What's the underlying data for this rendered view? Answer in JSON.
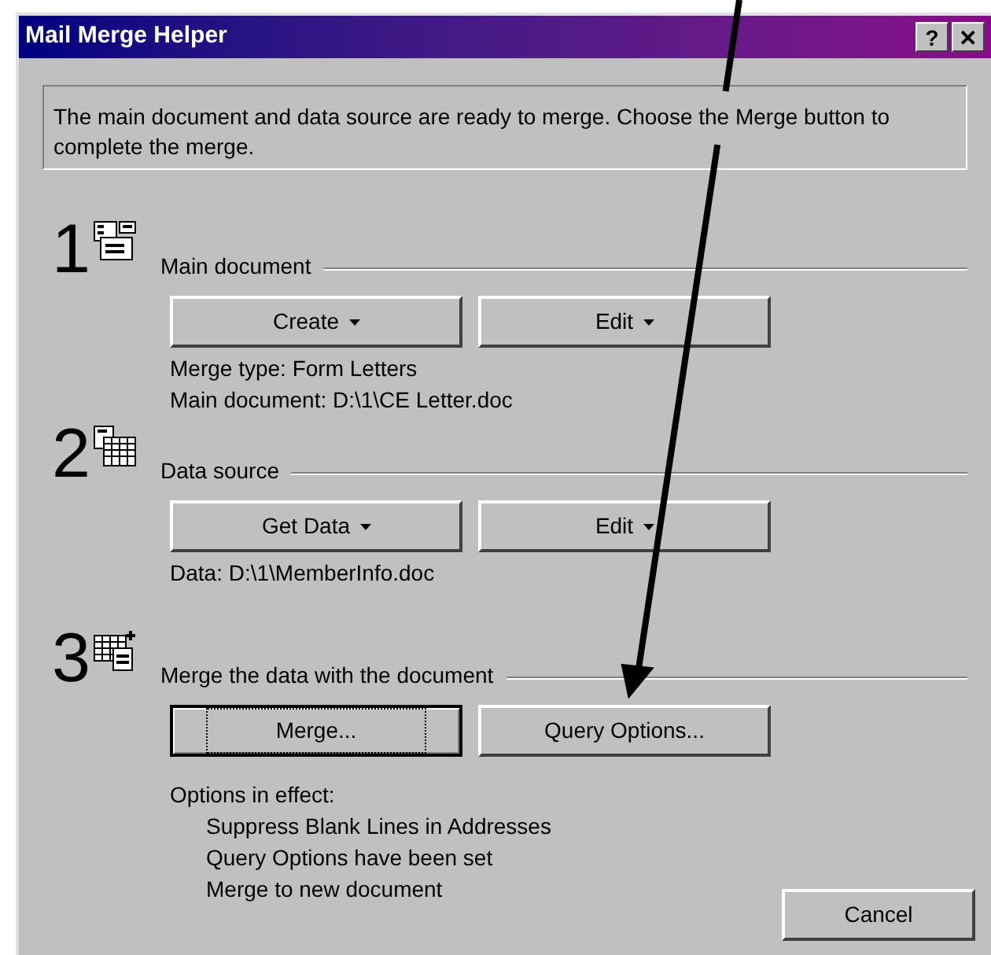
{
  "window": {
    "title": "Mail Merge Helper",
    "title_buttons": [
      "?",
      "✕"
    ]
  },
  "intro": "The main document and data source are ready to merge. Choose the Merge button to complete the merge.",
  "steps": [
    {
      "number": "1",
      "kind": "main",
      "heading": "Main document",
      "buttons": [
        {
          "label": "Create",
          "dropdown": true,
          "focused": false
        },
        {
          "label": "Edit",
          "dropdown": true,
          "focused": false
        }
      ],
      "info": [
        "Merge type: Form Letters",
        "Main document: D:\\1\\CE Letter.doc"
      ]
    },
    {
      "number": "2",
      "kind": "data",
      "heading": "Data source",
      "buttons": [
        {
          "label": "Get Data",
          "dropdown": true,
          "focused": false
        },
        {
          "label": "Edit",
          "dropdown": true,
          "focused": false
        }
      ],
      "info": [
        "Data: D:\\1\\MemberInfo.doc"
      ]
    },
    {
      "number": "3",
      "kind": "merge",
      "heading": "Merge the data with the document",
      "buttons": [
        {
          "label": "Merge...",
          "dropdown": false,
          "focused": true
        },
        {
          "label": "Query Options...",
          "dropdown": false,
          "focused": false
        }
      ],
      "info": [
        "Options in effect:"
      ],
      "options": [
        "Suppress Blank Lines in Addresses",
        "Query Options have been set",
        "Merge to new document"
      ]
    }
  ],
  "cancel": "Cancel"
}
